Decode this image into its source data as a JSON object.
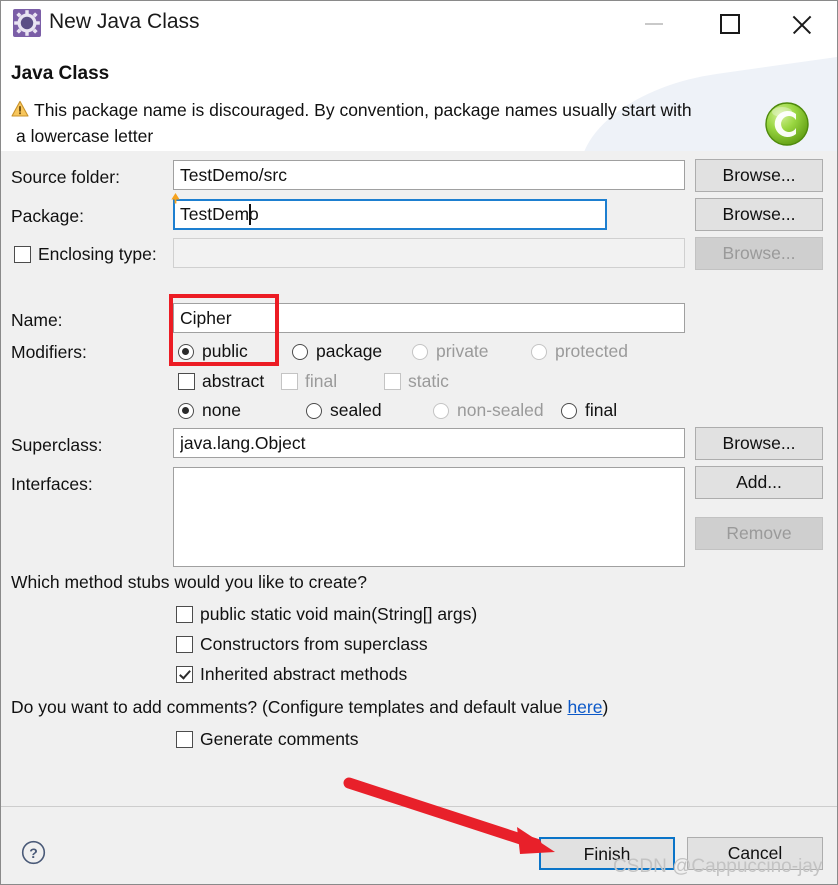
{
  "window": {
    "title": "New Java Class",
    "icon": "java-class-gear-icon",
    "controls": {
      "minimize": "minimize-icon",
      "maximize": "maximize-icon",
      "close": "close-icon"
    }
  },
  "header": {
    "title": "Java Class",
    "status_icon": "warning-triangle-icon",
    "message_line1": "This package name is discouraged. By convention, package names usually start with",
    "message_line2": "a lowercase letter",
    "brand_logo": "eclipse-green-c-logo"
  },
  "form": {
    "source_folder": {
      "label": "Source folder:",
      "value": "TestDemo/src",
      "browse": "Browse..."
    },
    "package": {
      "label": "Package:",
      "value": "TestDemo",
      "browse": "Browse...",
      "focused": true,
      "marker": "warning-marker-icon"
    },
    "enclosing_type": {
      "label": "Enclosing type:",
      "value": "",
      "checked": false,
      "browse": "Browse...",
      "disabled": true
    },
    "name": {
      "label": "Name:",
      "value": "Cipher"
    },
    "modifiers": {
      "label": "Modifiers:",
      "access": [
        {
          "label": "public",
          "selected": true,
          "disabled": false
        },
        {
          "label": "package",
          "selected": false,
          "disabled": false
        },
        {
          "label": "private",
          "selected": false,
          "disabled": true
        },
        {
          "label": "protected",
          "selected": false,
          "disabled": true
        }
      ],
      "flags": [
        {
          "label": "abstract",
          "checked": false,
          "disabled": false
        },
        {
          "label": "final",
          "checked": false,
          "disabled": true
        },
        {
          "label": "static",
          "checked": false,
          "disabled": true
        }
      ],
      "sealed": [
        {
          "label": "none",
          "selected": true,
          "disabled": false
        },
        {
          "label": "sealed",
          "selected": false,
          "disabled": false
        },
        {
          "label": "non-sealed",
          "selected": false,
          "disabled": true
        },
        {
          "label": "final",
          "selected": false,
          "disabled": false
        }
      ]
    },
    "superclass": {
      "label": "Superclass:",
      "value": "java.lang.Object",
      "browse": "Browse..."
    },
    "interfaces": {
      "label": "Interfaces:",
      "items": [],
      "add": "Add...",
      "remove": "Remove",
      "remove_disabled": true
    }
  },
  "stubs": {
    "question": "Which method stubs would you like to create?",
    "options": [
      {
        "label": "public static void main(String[] args)",
        "checked": false
      },
      {
        "label": "Constructors from superclass",
        "checked": false
      },
      {
        "label": "Inherited abstract methods",
        "checked": true
      }
    ]
  },
  "comments": {
    "question_prefix": "Do you want to add comments? (Configure templates and default value ",
    "link": "here",
    "question_suffix": ")",
    "option": {
      "label": "Generate comments",
      "checked": false
    }
  },
  "footer": {
    "help_icon": "help-question-icon",
    "finish": "Finish",
    "cancel": "Cancel",
    "watermark": "CSDN @Cappuccino-jay"
  },
  "annotations": {
    "highlight_box": "red-rectangle-around-name-and-public",
    "arrow": "red-arrow-pointing-to-finish",
    "accent_red": "#ec1c24",
    "focus_blue": "#0a74c8"
  }
}
